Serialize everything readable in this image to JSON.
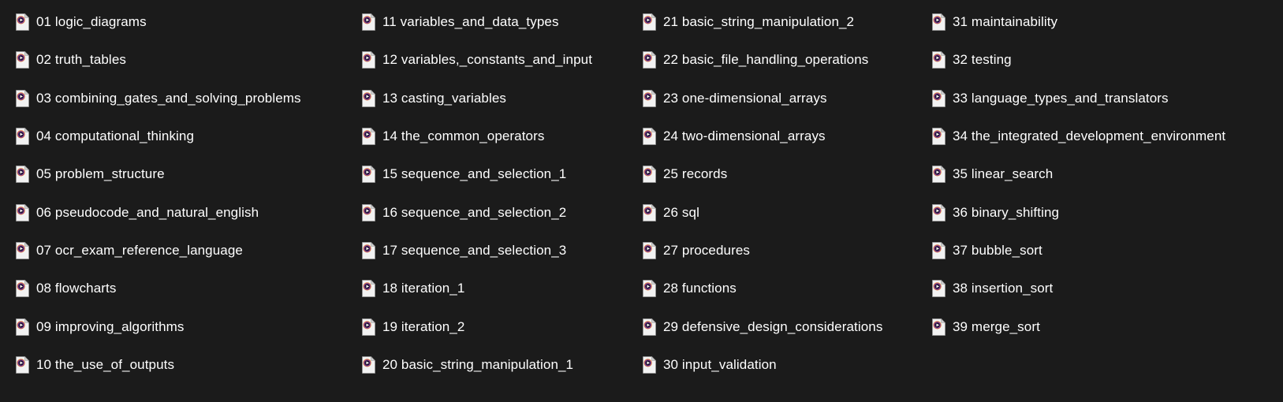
{
  "window": {
    "view_mode": "List",
    "background_color": "#1b1b1b",
    "text_color": "#ffffff",
    "item_count": 39
  },
  "icon": {
    "semantic_name": "video-file-icon",
    "page_color": "#f2f2f2",
    "page_fold_color": "#d0d0d0",
    "badge_outer_color": "#e0762a",
    "badge_inner_color": "#7b3fa0",
    "badge_core_color": "#241430",
    "play_color": "#ffffff"
  },
  "columns": [
    {
      "index": 1,
      "items": [
        {
          "number": "01",
          "name": "logic_diagrams",
          "label": "01 logic_diagrams"
        },
        {
          "number": "02",
          "name": "truth_tables",
          "label": "02 truth_tables"
        },
        {
          "number": "03",
          "name": "combining_gates_and_solving_problems",
          "label": "03 combining_gates_and_solving_problems"
        },
        {
          "number": "04",
          "name": "computational_thinking",
          "label": "04 computational_thinking"
        },
        {
          "number": "05",
          "name": "problem_structure",
          "label": "05 problem_structure"
        },
        {
          "number": "06",
          "name": "pseudocode_and_natural_english",
          "label": "06 pseudocode_and_natural_english"
        },
        {
          "number": "07",
          "name": "ocr_exam_reference_language",
          "label": "07 ocr_exam_reference_language"
        },
        {
          "number": "08",
          "name": "flowcharts",
          "label": "08 flowcharts"
        },
        {
          "number": "09",
          "name": "improving_algorithms",
          "label": "09 improving_algorithms"
        },
        {
          "number": "10",
          "name": "the_use_of_outputs",
          "label": "10 the_use_of_outputs"
        }
      ]
    },
    {
      "index": 2,
      "items": [
        {
          "number": "11",
          "name": "variables_and_data_types",
          "label": "11 variables_and_data_types"
        },
        {
          "number": "12",
          "name": "variables,_constants_and_input",
          "label": "12 variables,_constants_and_input"
        },
        {
          "number": "13",
          "name": "casting_variables",
          "label": "13 casting_variables"
        },
        {
          "number": "14",
          "name": "the_common_operators",
          "label": "14 the_common_operators"
        },
        {
          "number": "15",
          "name": "sequence_and_selection_1",
          "label": "15 sequence_and_selection_1"
        },
        {
          "number": "16",
          "name": "sequence_and_selection_2",
          "label": "16 sequence_and_selection_2"
        },
        {
          "number": "17",
          "name": "sequence_and_selection_3",
          "label": "17 sequence_and_selection_3"
        },
        {
          "number": "18",
          "name": "iteration_1",
          "label": "18 iteration_1"
        },
        {
          "number": "19",
          "name": "iteration_2",
          "label": "19 iteration_2"
        },
        {
          "number": "20",
          "name": "basic_string_manipulation_1",
          "label": "20 basic_string_manipulation_1"
        }
      ]
    },
    {
      "index": 3,
      "items": [
        {
          "number": "21",
          "name": "basic_string_manipulation_2",
          "label": "21 basic_string_manipulation_2"
        },
        {
          "number": "22",
          "name": "basic_file_handling_operations",
          "label": "22 basic_file_handling_operations"
        },
        {
          "number": "23",
          "name": "one-dimensional_arrays",
          "label": "23 one-dimensional_arrays"
        },
        {
          "number": "24",
          "name": "two-dimensional_arrays",
          "label": "24 two-dimensional_arrays"
        },
        {
          "number": "25",
          "name": "records",
          "label": "25 records"
        },
        {
          "number": "26",
          "name": "sql",
          "label": "26 sql"
        },
        {
          "number": "27",
          "name": "procedures",
          "label": "27 procedures"
        },
        {
          "number": "28",
          "name": "functions",
          "label": "28 functions"
        },
        {
          "number": "29",
          "name": "defensive_design_considerations",
          "label": "29 defensive_design_considerations"
        },
        {
          "number": "30",
          "name": "input_validation",
          "label": "30 input_validation"
        }
      ]
    },
    {
      "index": 4,
      "items": [
        {
          "number": "31",
          "name": "maintainability",
          "label": "31 maintainability"
        },
        {
          "number": "32",
          "name": "testing",
          "label": "32 testing"
        },
        {
          "number": "33",
          "name": "language_types_and_translators",
          "label": "33 language_types_and_translators"
        },
        {
          "number": "34",
          "name": "the_integrated_development_environment",
          "label": "34 the_integrated_development_environment"
        },
        {
          "number": "35",
          "name": "linear_search",
          "label": "35 linear_search"
        },
        {
          "number": "36",
          "name": "binary_shifting",
          "label": "36 binary_shifting"
        },
        {
          "number": "37",
          "name": "bubble_sort",
          "label": "37 bubble_sort"
        },
        {
          "number": "38",
          "name": "insertion_sort",
          "label": "38 insertion_sort"
        },
        {
          "number": "39",
          "name": "merge_sort",
          "label": "39 merge_sort"
        }
      ]
    }
  ]
}
